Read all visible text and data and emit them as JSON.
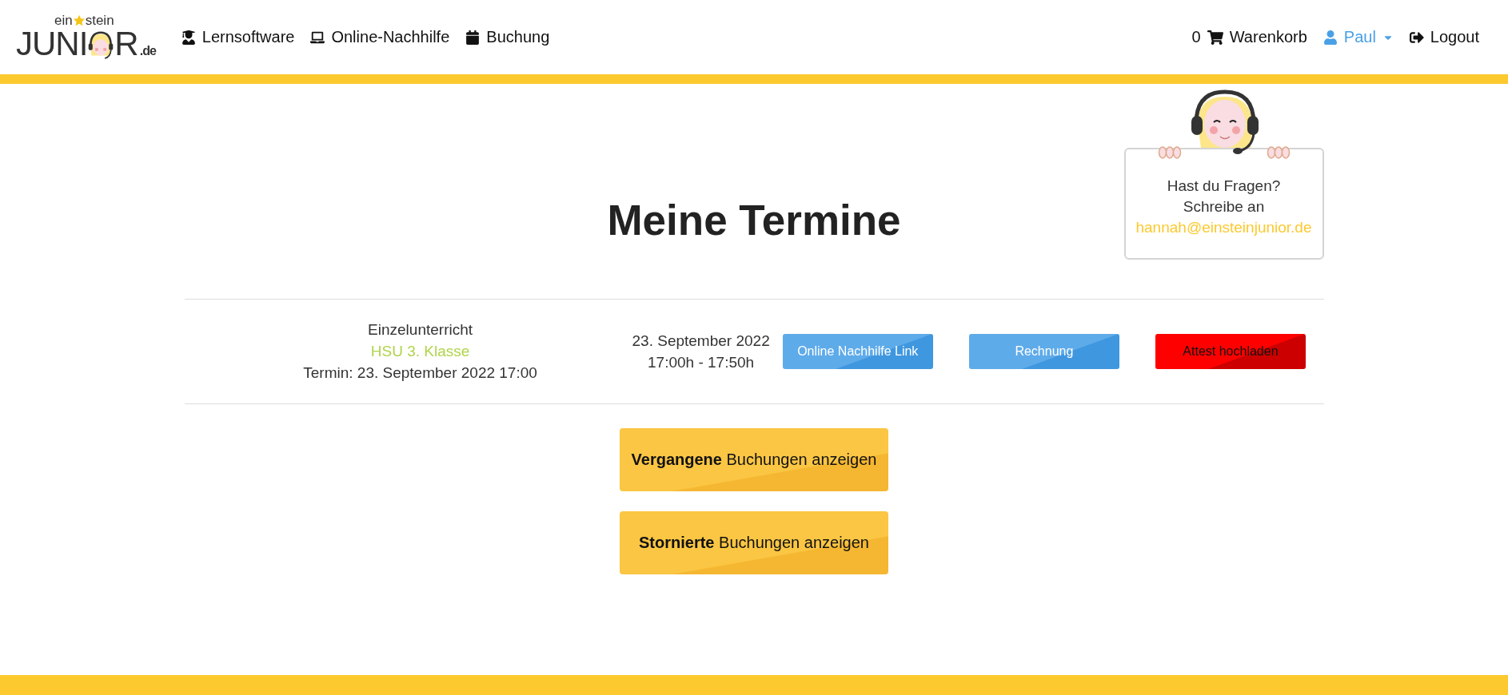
{
  "header": {
    "logo": {
      "top_left": "ein",
      "top_right": "stein",
      "main_left": "JUNI",
      "main_right": "R",
      "suffix": ".de"
    },
    "nav": [
      {
        "label": "Lernsoftware"
      },
      {
        "label": "Online-Nachhilfe"
      },
      {
        "label": "Buchung"
      }
    ],
    "cart": {
      "count": "0",
      "label": "Warenkorb"
    },
    "user": {
      "label": "Paul"
    },
    "logout": {
      "label": "Logout"
    }
  },
  "help_card": {
    "lines": [
      "Hast du Fragen?",
      "Schreibe an"
    ],
    "email": "hannah@einsteinjunior.de"
  },
  "title": "Meine Termine",
  "appointments": [
    {
      "type": "Einzelunterricht",
      "subject": "HSU 3. Klasse",
      "termin": "Termin: 23. September 2022 17:00",
      "date": "23. September 2022",
      "time": "17:00h - 17:50h",
      "actions": [
        {
          "label": "Online Nachhilfe Link",
          "kind": "primary"
        },
        {
          "label": "Rechnung",
          "kind": "primary"
        },
        {
          "label": "Attest hochladen",
          "kind": "danger"
        }
      ]
    }
  ],
  "toggles": [
    "**Vergangene** Buchungen anzeigen",
    "**Stornierte** Buchungen anzeigen"
  ]
}
